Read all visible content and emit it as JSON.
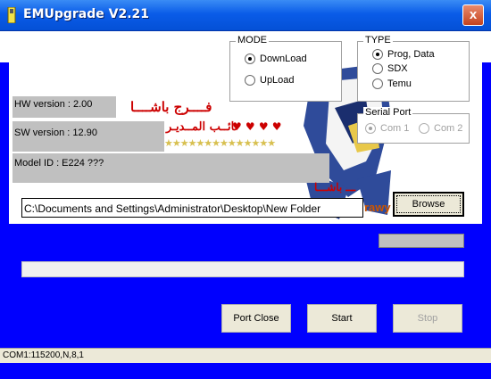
{
  "window": {
    "title": "EMUpgrade V2.21",
    "close_glyph": "x"
  },
  "info": {
    "hw": "HW version : 2.00",
    "sw": "SW version : 12.90",
    "model": "Model ID : E224    ???"
  },
  "decor": {
    "arabic_line1": "فــــرج باشــــا",
    "arabic_line2": "نائــب المــديـر",
    "arabic_line3": "ـــ باشـــا",
    "brand_fragment": "rawy",
    "hearts": "♥ ♥ ♥ ♥",
    "stars": "★★★★★★★★★★★★★★"
  },
  "mode": {
    "title": "MODE",
    "options": [
      {
        "label": "DownLoad",
        "selected": true
      },
      {
        "label": "UpLoad",
        "selected": false
      }
    ]
  },
  "type": {
    "title": "TYPE",
    "options": [
      {
        "label": "Prog, Data",
        "selected": true
      },
      {
        "label": "SDX",
        "selected": false
      },
      {
        "label": "Temu",
        "selected": false
      }
    ]
  },
  "serial": {
    "title": "Serial Port",
    "options": [
      {
        "label": "Com 1",
        "selected": true
      },
      {
        "label": "Com 2",
        "selected": false
      }
    ]
  },
  "path": {
    "value": "C:\\Documents and Settings\\Administrator\\Desktop\\New Folder"
  },
  "buttons": {
    "browse": "Browse",
    "port_close": "Port Close",
    "start": "Start",
    "stop": "Stop"
  },
  "status": {
    "text": "COM1:115200,N,8,1"
  },
  "progress": {
    "small": 0,
    "main": 0
  },
  "colors": {
    "background_blue": "#0000fe",
    "titlebar": "#0a5ce8",
    "arabic_red": "#cc0000"
  }
}
